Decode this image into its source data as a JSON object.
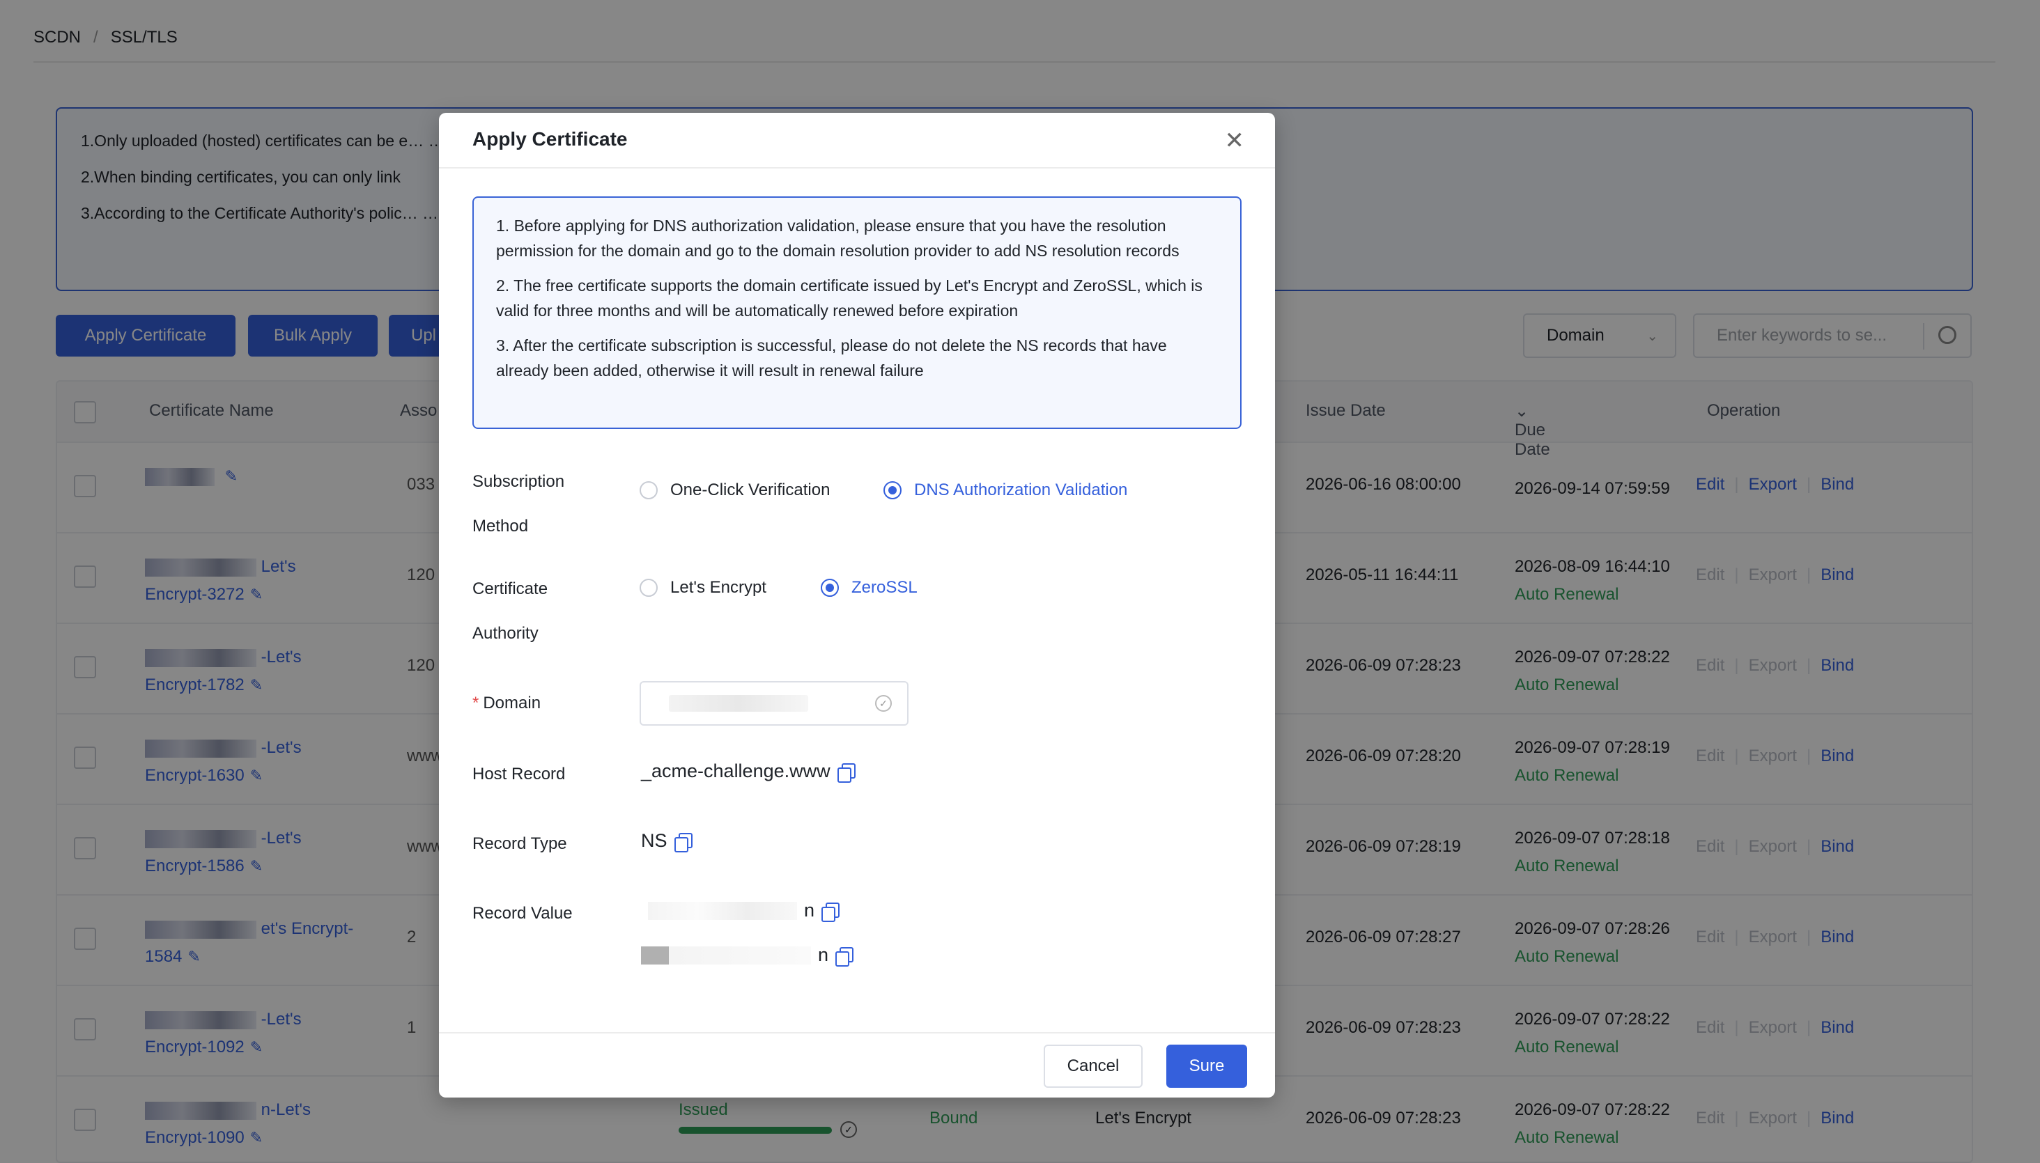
{
  "breadcrumb": {
    "root": "SCDN",
    "current": "SSL/TLS"
  },
  "notice": {
    "line1": "1.Only uploaded (hosted) certificates can be e…                                                                                                                         …al certificate. After saving, the domains will automatically switch to the new certificate.",
    "line2": "2.When binding certificates, you can only link",
    "line3": "3.According to the Certificate Authority's polic…                                                                                                                       …p to 5 duplicate certificates per week. For example, in www.example.com, the registered domain is example.com."
  },
  "toolbar": {
    "apply_label": "Apply Certificate",
    "bulk_label": "Bulk Apply",
    "upload_label": "Upl",
    "filter_value": "Domain",
    "search_placeholder": "Enter keywords to se..."
  },
  "table": {
    "headers": {
      "name": "Certificate Name",
      "assoc": "Asso",
      "issue": "Issue Date",
      "due": "Due Date",
      "op": "Operation"
    },
    "ops": {
      "edit": "Edit",
      "export": "Export",
      "bind": "Bind"
    },
    "auto_renewal": "Auto Renewal",
    "rows": [
      {
        "name": "",
        "assoc": "033",
        "issue": "2026-06-16 08:00:00",
        "due": "2026-09-14 07:59:59",
        "renew": false
      },
      {
        "name": "Let's Encrypt-3272",
        "assoc": "120",
        "issue": "2026-05-11 16:44:11",
        "due": "2026-08-09 16:44:10",
        "renew": true
      },
      {
        "name": "-Let's Encrypt-1782",
        "assoc": "120",
        "issue": "2026-06-09 07:28:23",
        "due": "2026-09-07 07:28:22",
        "renew": true
      },
      {
        "name": "-Let's Encrypt-1630",
        "assoc": "www",
        "issue": "2026-06-09 07:28:20",
        "due": "2026-09-07 07:28:19",
        "renew": true
      },
      {
        "name": "-Let's Encrypt-1586",
        "assoc": "www",
        "issue": "2026-06-09 07:28:19",
        "due": "2026-09-07 07:28:18",
        "renew": true
      },
      {
        "name": "et's Encrypt-1584",
        "assoc": "2",
        "issue": "2026-06-09 07:28:27",
        "due": "2026-09-07 07:28:26",
        "renew": true
      },
      {
        "name": "-Let's Encrypt-1092",
        "assoc": "1",
        "issue": "2026-06-09 07:28:23",
        "due": "2026-09-07 07:28:22",
        "renew": true
      },
      {
        "name": "n-Let's Encrypt-1090",
        "assoc": "",
        "issue": "2026-06-09 07:28:23",
        "due": "2026-09-07 07:28:22",
        "renew": true,
        "status": "Issued",
        "bound": "Bound",
        "authority": "Let's Encrypt",
        "progress": 1.0
      }
    ]
  },
  "modal": {
    "title": "Apply Certificate",
    "tips": [
      "1. Before applying for DNS authorization validation, please ensure that you have the resolution permission for the domain and go to the domain resolution provider to add NS resolution records",
      "2. The free certificate supports the domain certificate issued by Let's Encrypt and ZeroSSL, which is valid for three months and will be automatically renewed before expiration",
      "3. After the certificate subscription is successful, please do not delete the NS records that have already been added, otherwise it will result in renewal failure"
    ],
    "sub_method_label_1": "Subscription",
    "sub_method_label_2": "Method",
    "opt_one_click": "One-Click Verification",
    "opt_dns": "DNS Authorization Validation",
    "ca_label_1": "Certificate",
    "ca_label_2": "Authority",
    "opt_le": "Let's Encrypt",
    "opt_zerossl": "ZeroSSL",
    "domain_label": "Domain",
    "host_label": "Host Record",
    "host_value": "_acme-challenge.www",
    "type_label": "Record Type",
    "type_value": "NS",
    "value_label": "Record Value",
    "value_suffix_1": "n",
    "value_suffix_2": "n",
    "cancel": "Cancel",
    "sure": "Sure"
  }
}
